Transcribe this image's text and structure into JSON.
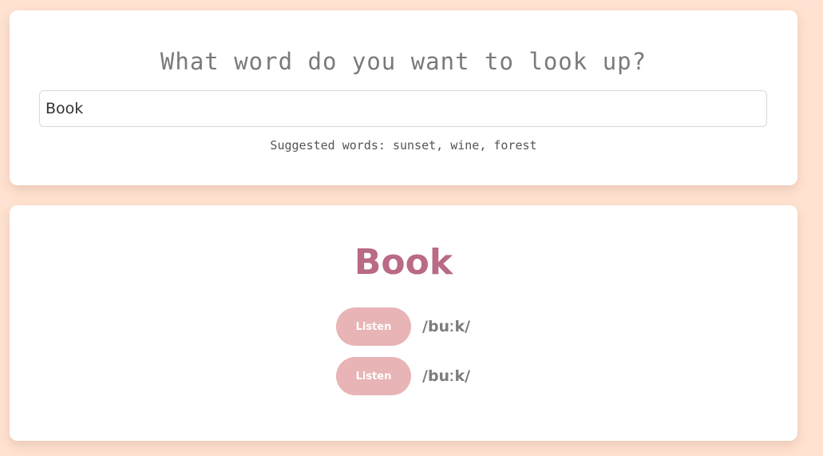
{
  "search": {
    "question": "What word do you want to look up?",
    "value": "Book",
    "suggestions": "Suggested words: sunset, wine, forest"
  },
  "result": {
    "word": "Book",
    "pronunciations": [
      {
        "listen_label": "Listen",
        "phonetic": "/buːk/"
      },
      {
        "listen_label": "Listen",
        "phonetic": "/buːk/"
      }
    ]
  },
  "colors": {
    "background": "#ffe2d1",
    "accent": "#b86a86",
    "button": "#e8b4b5"
  }
}
